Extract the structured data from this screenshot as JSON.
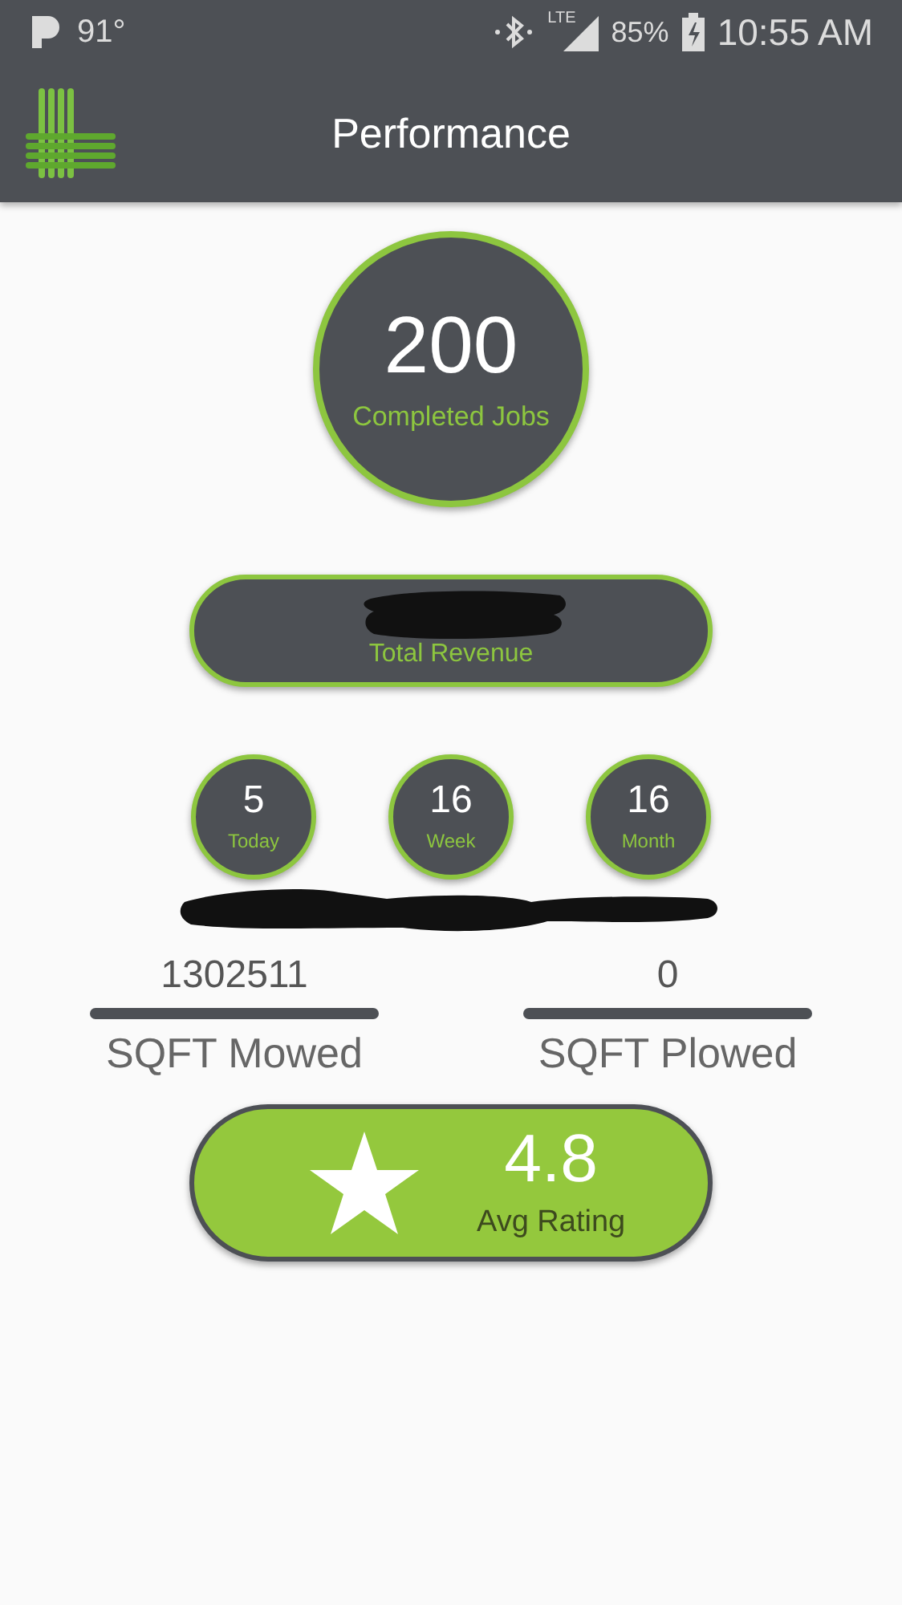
{
  "status_bar": {
    "temperature": "91°",
    "network": "LTE",
    "battery": "85%",
    "time": "10:55 AM"
  },
  "app_bar": {
    "title": "Performance"
  },
  "completed": {
    "value": "200",
    "label": "Completed Jobs"
  },
  "revenue": {
    "label": "Total Revenue"
  },
  "periods": [
    {
      "value": "5",
      "label": "Today"
    },
    {
      "value": "16",
      "label": "Week"
    },
    {
      "value": "16",
      "label": "Month"
    }
  ],
  "sqft": [
    {
      "value": "1302511",
      "label": "SQFT Mowed"
    },
    {
      "value": "0",
      "label": "SQFT Plowed"
    }
  ],
  "rating": {
    "value": "4.8",
    "label": "Avg Rating"
  }
}
